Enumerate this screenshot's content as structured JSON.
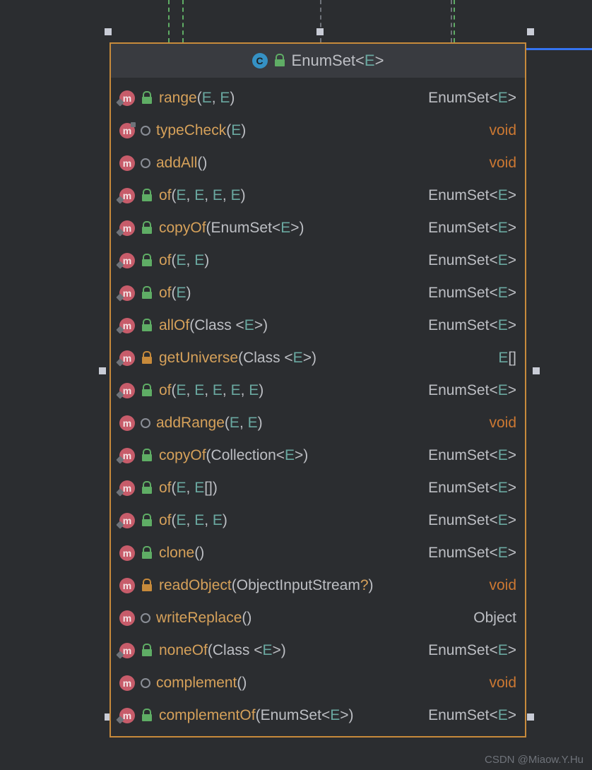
{
  "watermark": "CSDN @Miaow.Y.Hu",
  "header": {
    "class_icon": "C",
    "lock_color": "green",
    "name": "EnumSet",
    "generic": "<E>"
  },
  "methods": [
    {
      "overlay": "diamond",
      "second": "lock",
      "second_color": "green",
      "name": "range",
      "params": [
        [
          "E"
        ],
        [
          "E"
        ]
      ],
      "ret": {
        "kind": "generic",
        "base": "EnumSet",
        "arg": "E"
      }
    },
    {
      "overlay": "up",
      "second": "dot",
      "name": "typeCheck",
      "params": [
        [
          "E"
        ]
      ],
      "ret": {
        "kind": "void"
      }
    },
    {
      "overlay": "none",
      "second": "dot",
      "name": "addAll",
      "params": [],
      "ret": {
        "kind": "void"
      }
    },
    {
      "overlay": "diamond",
      "second": "lock",
      "second_color": "green",
      "name": "of",
      "params": [
        [
          "E"
        ],
        [
          "E"
        ],
        [
          "E"
        ],
        [
          "E"
        ]
      ],
      "ret": {
        "kind": "generic",
        "base": "EnumSet",
        "arg": "E"
      }
    },
    {
      "overlay": "diamond",
      "second": "lock",
      "second_color": "green",
      "name": "copyOf",
      "params": [
        [
          "EnumSet<",
          "E",
          ">"
        ]
      ],
      "ret": {
        "kind": "generic",
        "base": "EnumSet",
        "arg": "E"
      }
    },
    {
      "overlay": "diamond",
      "second": "lock",
      "second_color": "green",
      "name": "of",
      "params": [
        [
          "E"
        ],
        [
          "E"
        ]
      ],
      "ret": {
        "kind": "generic",
        "base": "EnumSet",
        "arg": "E"
      }
    },
    {
      "overlay": "diamond",
      "second": "lock",
      "second_color": "green",
      "name": "of",
      "params": [
        [
          "E"
        ]
      ],
      "ret": {
        "kind": "generic",
        "base": "EnumSet",
        "arg": "E"
      }
    },
    {
      "overlay": "diamond",
      "second": "lock",
      "second_color": "green",
      "name": "allOf",
      "params": [
        [
          "Class <",
          "E",
          ">"
        ]
      ],
      "ret": {
        "kind": "generic",
        "base": "EnumSet",
        "arg": "E"
      }
    },
    {
      "overlay": "diamond",
      "second": "lock",
      "second_color": "orange",
      "name": "getUniverse",
      "params": [
        [
          "Class <",
          "E",
          ">"
        ]
      ],
      "ret": {
        "kind": "array",
        "base": "E"
      }
    },
    {
      "overlay": "diamond",
      "second": "lock",
      "second_color": "green",
      "name": "of",
      "params": [
        [
          "E"
        ],
        [
          "E"
        ],
        [
          "E"
        ],
        [
          "E"
        ],
        [
          "E"
        ]
      ],
      "ret": {
        "kind": "generic",
        "base": "EnumSet",
        "arg": "E"
      }
    },
    {
      "overlay": "none",
      "second": "dot",
      "name": "addRange",
      "params": [
        [
          "E"
        ],
        [
          "E"
        ]
      ],
      "ret": {
        "kind": "void"
      }
    },
    {
      "overlay": "diamond",
      "second": "lock",
      "second_color": "green",
      "name": "copyOf",
      "params": [
        [
          "Collection<",
          "E",
          ">"
        ]
      ],
      "ret": {
        "kind": "generic",
        "base": "EnumSet",
        "arg": "E"
      }
    },
    {
      "overlay": "diamond",
      "second": "lock",
      "second_color": "green",
      "name": "of",
      "params": [
        [
          "E"
        ],
        [
          "E",
          "[]"
        ]
      ],
      "ret": {
        "kind": "generic",
        "base": "EnumSet",
        "arg": "E"
      }
    },
    {
      "overlay": "diamond",
      "second": "lock",
      "second_color": "green",
      "name": "of",
      "params": [
        [
          "E"
        ],
        [
          "E"
        ],
        [
          "E"
        ]
      ],
      "ret": {
        "kind": "generic",
        "base": "EnumSet",
        "arg": "E"
      }
    },
    {
      "overlay": "none",
      "second": "lock",
      "second_color": "green",
      "name": "clone",
      "params": [],
      "ret": {
        "kind": "generic",
        "base": "EnumSet",
        "arg": "E"
      }
    },
    {
      "overlay": "none",
      "second": "lock",
      "second_color": "orange",
      "name": "readObject",
      "params": [
        [
          "ObjectInputStream",
          "?",
          ""
        ]
      ],
      "q": true,
      "ret": {
        "kind": "void"
      }
    },
    {
      "overlay": "none",
      "second": "dot",
      "name": "writeReplace",
      "params": [],
      "ret": {
        "kind": "plain",
        "base": "Object"
      }
    },
    {
      "overlay": "diamond",
      "second": "lock",
      "second_color": "green",
      "name": "noneOf",
      "params": [
        [
          "Class <",
          "E",
          ">"
        ]
      ],
      "ret": {
        "kind": "generic",
        "base": "EnumSet",
        "arg": "E"
      }
    },
    {
      "overlay": "none",
      "second": "dot",
      "name": "complement",
      "params": [],
      "ret": {
        "kind": "void"
      }
    },
    {
      "overlay": "diamond",
      "second": "lock",
      "second_color": "green",
      "name": "complementOf",
      "params": [
        [
          "EnumSet<",
          "E",
          ">"
        ]
      ],
      "ret": {
        "kind": "generic",
        "base": "EnumSet",
        "arg": "E"
      }
    }
  ]
}
